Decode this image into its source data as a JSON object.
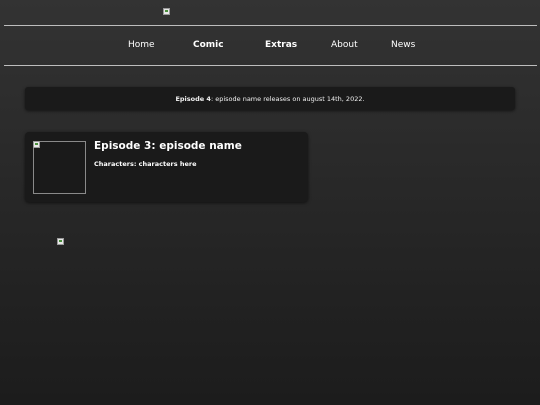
{
  "header": {
    "logo_icon": "broken-image-icon"
  },
  "nav": {
    "items": [
      {
        "label": "Home",
        "bold": false
      },
      {
        "label": "Comic",
        "bold": true
      },
      {
        "label": "Extras",
        "bold": true
      },
      {
        "label": "About",
        "bold": false
      },
      {
        "label": "News",
        "bold": false
      }
    ]
  },
  "announcement": {
    "label": "Episode 4",
    "text": ": episode name releases on august 14th, 2022."
  },
  "episode_card": {
    "title": "Episode 3: episode name",
    "characters": "Characters: characters here",
    "thumbnail_icon": "broken-image-icon"
  },
  "footer_image_icon": "broken-image-icon",
  "colors": {
    "background_top": "#333333",
    "background_bottom": "#1c1c1c",
    "card_bg": "#1a1a1a",
    "rule": "#bdbdbd"
  }
}
